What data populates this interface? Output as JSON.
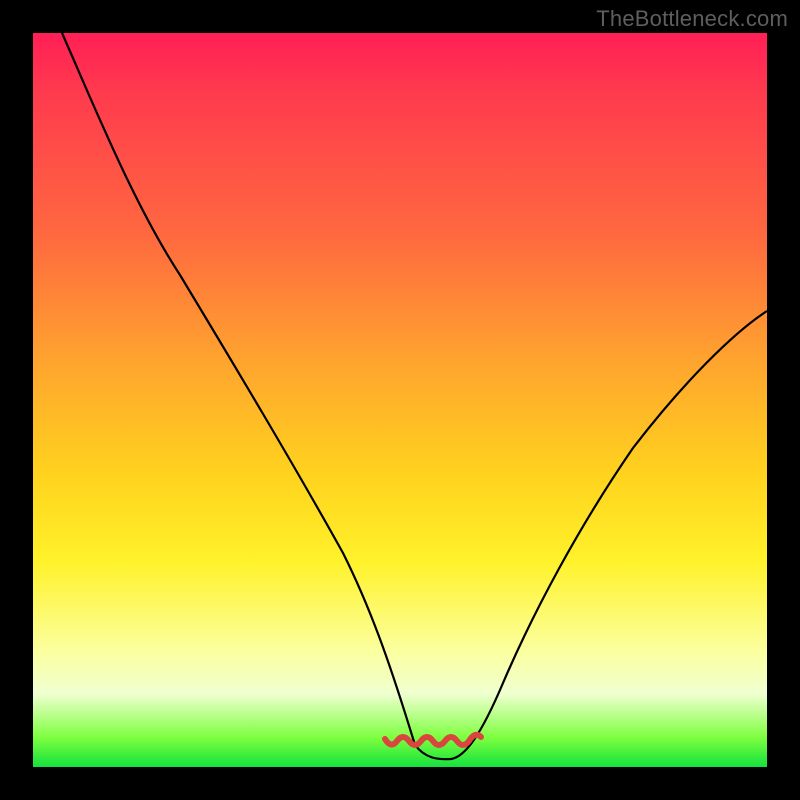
{
  "watermark": "TheBottleneck.com",
  "chart_data": {
    "type": "line",
    "title": "",
    "xlabel": "",
    "ylabel": "",
    "xlim": [
      0,
      100
    ],
    "ylim": [
      0,
      100
    ],
    "series": [
      {
        "name": "black-curve",
        "color": "#000000",
        "x": [
          4,
          10,
          20,
          30,
          40,
          47,
          52,
          57,
          62,
          70,
          80,
          90,
          100
        ],
        "values": [
          100,
          87,
          67,
          47,
          27,
          11,
          3,
          1,
          3,
          13,
          30,
          46,
          60
        ]
      },
      {
        "name": "red-bottom-squiggle",
        "color": "#d9453f",
        "x": [
          48,
          50,
          52,
          54,
          56,
          58,
          60,
          62
        ],
        "values": [
          3.5,
          2.0,
          1.4,
          1.2,
          1.2,
          1.4,
          2.0,
          3.5
        ]
      }
    ]
  }
}
